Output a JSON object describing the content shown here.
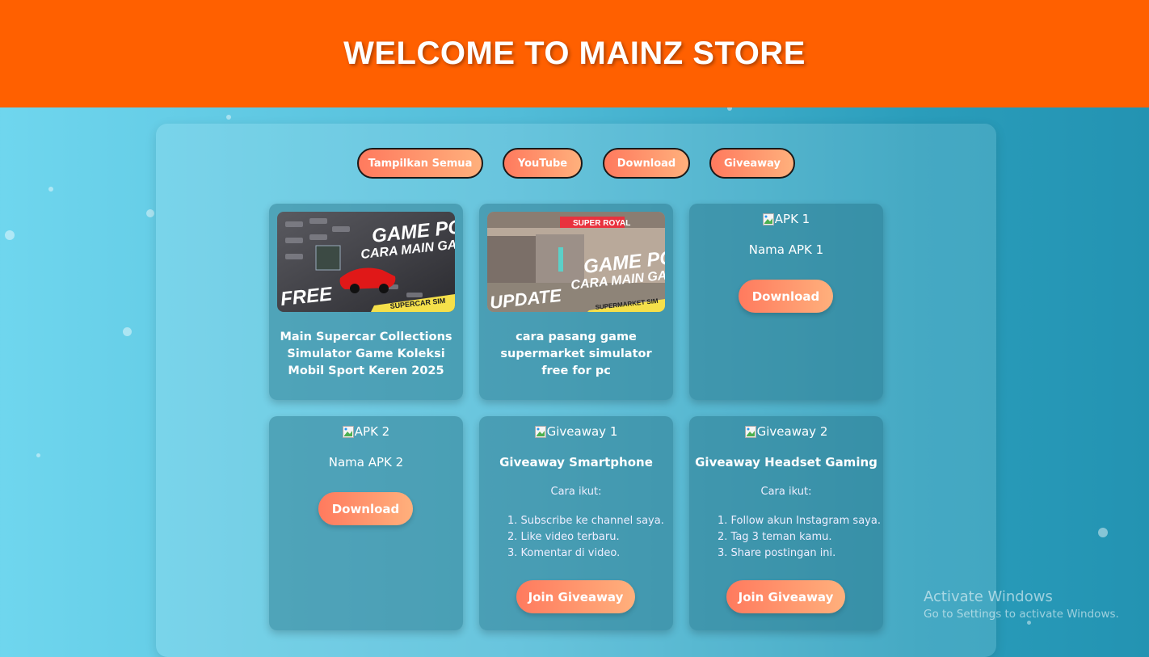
{
  "header": {
    "title": "WELCOME TO MAINZ STORE"
  },
  "filters": [
    "Tampilkan Semua",
    "YouTube",
    "Download",
    "Giveaway"
  ],
  "videos": [
    {
      "thumb_badge": "FREE",
      "thumb_title_line1": "GAME PC",
      "thumb_title_line2": "CARA MAIN GAME",
      "thumb_tag": "SUPERCAR SIM",
      "title": "Main Supercar Collections Simulator Game Koleksi Mobil Sport Keren 2025"
    },
    {
      "thumb_badge": "UPDATE",
      "thumb_title_line1": "GAME PC",
      "thumb_title_line2": "CARA MAIN GAME",
      "thumb_tag": "SUPERMARKET SIM",
      "thumb_sign": "SUPER ROYAL",
      "title": "cara pasang game supermarket simulator free for pc"
    }
  ],
  "apks": [
    {
      "alt": "APK 1",
      "name": "Nama APK 1",
      "button": "Download"
    },
    {
      "alt": "APK 2",
      "name": "Nama APK 2",
      "button": "Download"
    }
  ],
  "giveaways": [
    {
      "alt": "Giveaway 1",
      "title": "Giveaway Smartphone",
      "howto": "Cara ikut:",
      "steps": [
        "1. Subscribe ke channel saya.",
        "2. Like video terbaru.",
        "3. Komentar di video."
      ],
      "button": "Join Giveaway"
    },
    {
      "alt": "Giveaway 2",
      "title": "Giveaway Headset Gaming",
      "howto": "Cara ikut:",
      "steps": [
        "1. Follow akun Instagram saya.",
        "2. Tag 3 teman kamu.",
        "3. Share postingan ini."
      ],
      "button": "Join Giveaway"
    }
  ],
  "watermark": {
    "line1": "Activate Windows",
    "line2": "Go to Settings to activate Windows."
  },
  "colors": {
    "header": "#ff6000",
    "button_start": "#ff7a5e",
    "button_end": "#ffb07c"
  }
}
